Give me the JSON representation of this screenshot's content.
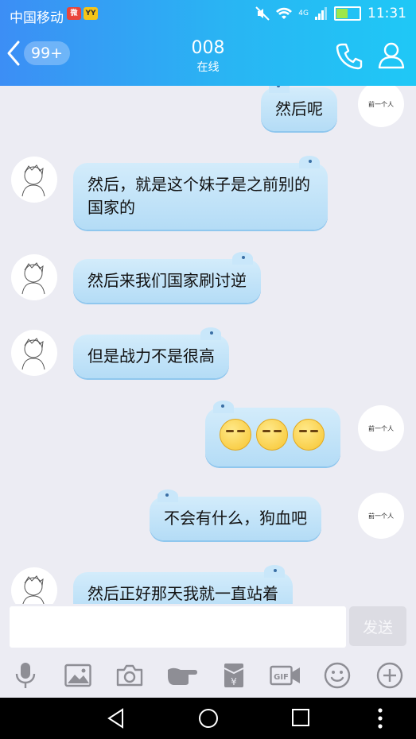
{
  "status": {
    "carrier": "中国移动",
    "badges": [
      "微",
      "YY"
    ],
    "network": "4G",
    "time": "11:31"
  },
  "header": {
    "unread_count": "99+",
    "title": "008",
    "subtitle": "在线"
  },
  "avatars": {
    "self_text": "前一个人"
  },
  "messages": [
    {
      "side": "right",
      "text": "然后呢"
    },
    {
      "side": "left",
      "text": "然后，就是这个妹子是之前别的国家的"
    },
    {
      "side": "left",
      "text": "然后来我们国家刷讨逆"
    },
    {
      "side": "left",
      "text": "但是战力不是很高"
    },
    {
      "side": "right",
      "text": "",
      "emoji_count": 3
    },
    {
      "side": "right",
      "text": "不会有什么，狗血吧"
    },
    {
      "side": "left",
      "text": "然后正好那天我就一直站着"
    }
  ],
  "input": {
    "placeholder": "",
    "send_label": "发送"
  },
  "toolbar": {
    "items": [
      "mic-icon",
      "image-icon",
      "camera-icon",
      "hand-icon",
      "red-packet-icon",
      "gif-icon",
      "emoji-icon",
      "plus-icon"
    ],
    "gif_label": "GIF",
    "yen_label": "¥"
  },
  "colors": {
    "accent": "#29b5f3",
    "bubble": "#c3e4f9"
  }
}
